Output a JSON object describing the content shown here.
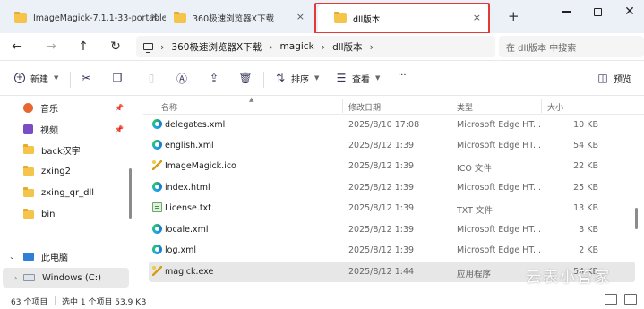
{
  "tabs": [
    {
      "title": "ImageMagick-7.1.1-33-portable"
    },
    {
      "title": "360极速浏览器X下载"
    },
    {
      "title": "dll版本"
    }
  ],
  "tab_close_glyph": "×",
  "add_tab_glyph": "+",
  "colors": {
    "highlight": "#e53935",
    "folder": "#f4c54a",
    "selected_row": "#e7e7e7"
  },
  "address": {
    "breadcrumbs": [
      "360极速浏览器X下载",
      "magick",
      "dll版本"
    ],
    "separator": "›",
    "search_placeholder": "在 dll版本 中搜索"
  },
  "toolbar": {
    "new_label": "新建",
    "sort_label": "排序",
    "view_label": "查看",
    "more_label": "···",
    "preview_label": "预览",
    "icons": [
      "cut-icon",
      "copy-icon",
      "paste-icon",
      "rename-icon",
      "share-icon",
      "delete-icon"
    ]
  },
  "sidebar": {
    "items": [
      {
        "label": "音乐",
        "icon": "music-icon",
        "pinned": true
      },
      {
        "label": "视频",
        "icon": "video-icon",
        "pinned": true
      },
      {
        "label": "back汉字",
        "icon": "folder-icon"
      },
      {
        "label": "zxing2",
        "icon": "folder-icon"
      },
      {
        "label": "zxing_qr_dll",
        "icon": "folder-icon"
      },
      {
        "label": "bin",
        "icon": "folder-icon"
      },
      {
        "label": "此电脑",
        "icon": "pc-icon"
      },
      {
        "label": "Windows (C:)",
        "icon": "drive-icon"
      }
    ]
  },
  "columns": {
    "name": "名称",
    "date": "修改日期",
    "type": "类型",
    "size": "大小"
  },
  "files": [
    {
      "name": "delegates.xml",
      "date": "2025/8/10 17:08",
      "type": "Microsoft Edge HT...",
      "size": "10 KB",
      "icon": "edge-icon"
    },
    {
      "name": "english.xml",
      "date": "2025/8/12 1:39",
      "type": "Microsoft Edge HT...",
      "size": "54 KB",
      "icon": "edge-icon"
    },
    {
      "name": "ImageMagick.ico",
      "date": "2025/8/12 1:39",
      "type": "ICO 文件",
      "size": "22 KB",
      "icon": "ico-icon"
    },
    {
      "name": "index.html",
      "date": "2025/8/12 1:39",
      "type": "Microsoft Edge HT...",
      "size": "25 KB",
      "icon": "edge-icon"
    },
    {
      "name": "License.txt",
      "date": "2025/8/12 1:39",
      "type": "TXT 文件",
      "size": "13 KB",
      "icon": "txt-icon"
    },
    {
      "name": "locale.xml",
      "date": "2025/8/12 1:39",
      "type": "Microsoft Edge HT...",
      "size": "3 KB",
      "icon": "edge-icon"
    },
    {
      "name": "log.xml",
      "date": "2025/8/12 1:39",
      "type": "Microsoft Edge HT...",
      "size": "2 KB",
      "icon": "edge-icon"
    },
    {
      "name": "magick.exe",
      "date": "2025/8/12 1:44",
      "type": "应用程序",
      "size": "54 KB",
      "icon": "exe-icon",
      "selected": true
    }
  ],
  "status": {
    "count": "63 个项目",
    "selected": "选中 1 个项目  53.9 KB"
  },
  "watermark": "云表小管家"
}
